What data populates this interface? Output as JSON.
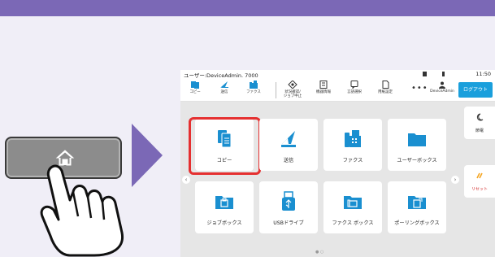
{
  "colors": {
    "accent_purple": "#7b68b6",
    "highlight_red": "#e53030",
    "logout_blue": "#1a9fdc",
    "tile_blue": "#1a8fd0",
    "tile_orange": "#f5a623"
  },
  "status": {
    "user": "ユーザー:DeviceAdmin. 7000",
    "time": "11:50"
  },
  "toolbar": [
    {
      "label": "コピー",
      "icon": "copy-icon"
    },
    {
      "label": "送信",
      "icon": "send-icon"
    },
    {
      "label": "ファクス",
      "icon": "fax-icon"
    },
    {
      "label": "状況確認/\nジョブ中止",
      "icon": "status-icon"
    },
    {
      "label": "機器情報",
      "icon": "device-info-icon"
    },
    {
      "label": "言語選択",
      "icon": "language-icon"
    },
    {
      "label": "用紙設定",
      "icon": "paper-icon"
    }
  ],
  "more": "•••",
  "admin_label": "DeviceAdmin",
  "logout_label": "ログアウト",
  "tiles": [
    {
      "label": "コピー",
      "icon": "copy-icon"
    },
    {
      "label": "送信",
      "icon": "send-icon"
    },
    {
      "label": "ファクス",
      "icon": "fax-icon"
    },
    {
      "label": "ユーザーボックス",
      "icon": "folder-icon"
    },
    {
      "label": "ジョブボックス",
      "icon": "job-box-icon"
    },
    {
      "label": "USBドライブ",
      "icon": "usb-icon"
    },
    {
      "label": "ファクス ボックス",
      "icon": "fax-box-icon"
    },
    {
      "label": "ポーリングボックス",
      "icon": "polling-box-icon"
    }
  ],
  "side": {
    "energy_label": "節電",
    "reset_label": "リセット"
  }
}
